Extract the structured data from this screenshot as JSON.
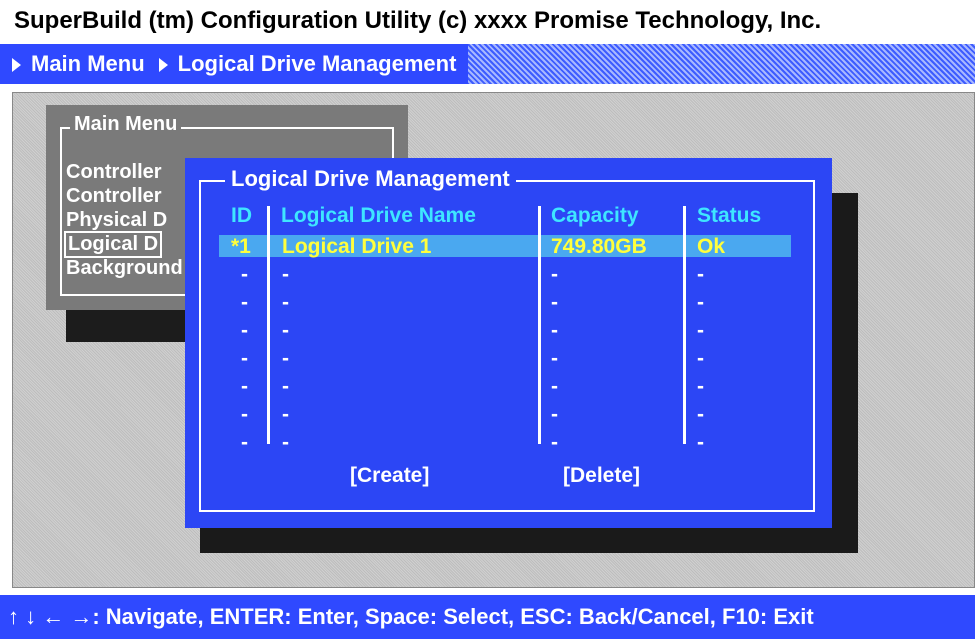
{
  "title": "SuperBuild (tm) Configuration Utility (c) xxxx Promise Technology, Inc.",
  "breadcrumb": [
    "Main Menu",
    "Logical Drive Management"
  ],
  "main_menu": {
    "title": "Main Menu",
    "items": [
      "Controller",
      "Controller",
      "Physical D",
      "Logical D",
      "Background"
    ],
    "selected_index": 3
  },
  "dialog": {
    "title": "Logical Drive Management",
    "columns": [
      "ID",
      "Logical Drive Name",
      "Capacity",
      "Status"
    ],
    "rows": [
      {
        "id": "*1",
        "name": "Logical Drive 1",
        "capacity": "749.80GB",
        "status": "Ok"
      },
      {
        "id": "-",
        "name": "-",
        "capacity": "-",
        "status": "-"
      },
      {
        "id": "-",
        "name": "-",
        "capacity": "-",
        "status": "-"
      },
      {
        "id": "-",
        "name": "-",
        "capacity": "-",
        "status": "-"
      },
      {
        "id": "-",
        "name": "-",
        "capacity": "-",
        "status": "-"
      },
      {
        "id": "-",
        "name": "-",
        "capacity": "-",
        "status": "-"
      },
      {
        "id": "-",
        "name": "-",
        "capacity": "-",
        "status": "-"
      },
      {
        "id": "-",
        "name": "-",
        "capacity": "-",
        "status": "-"
      }
    ],
    "buttons": {
      "create": "[Create]",
      "delete": "[Delete]"
    }
  },
  "status_bar": "↑ ↓ ← →: Navigate, ENTER: Enter, Space: Select, ESC: Back/Cancel, F10: Exit",
  "colors": {
    "blue": "#2c46f5",
    "highlight": "#4aa8f0",
    "yellow": "#ffff3c",
    "cyan": "#3ee6ff",
    "gray": "#7a7a7a"
  }
}
